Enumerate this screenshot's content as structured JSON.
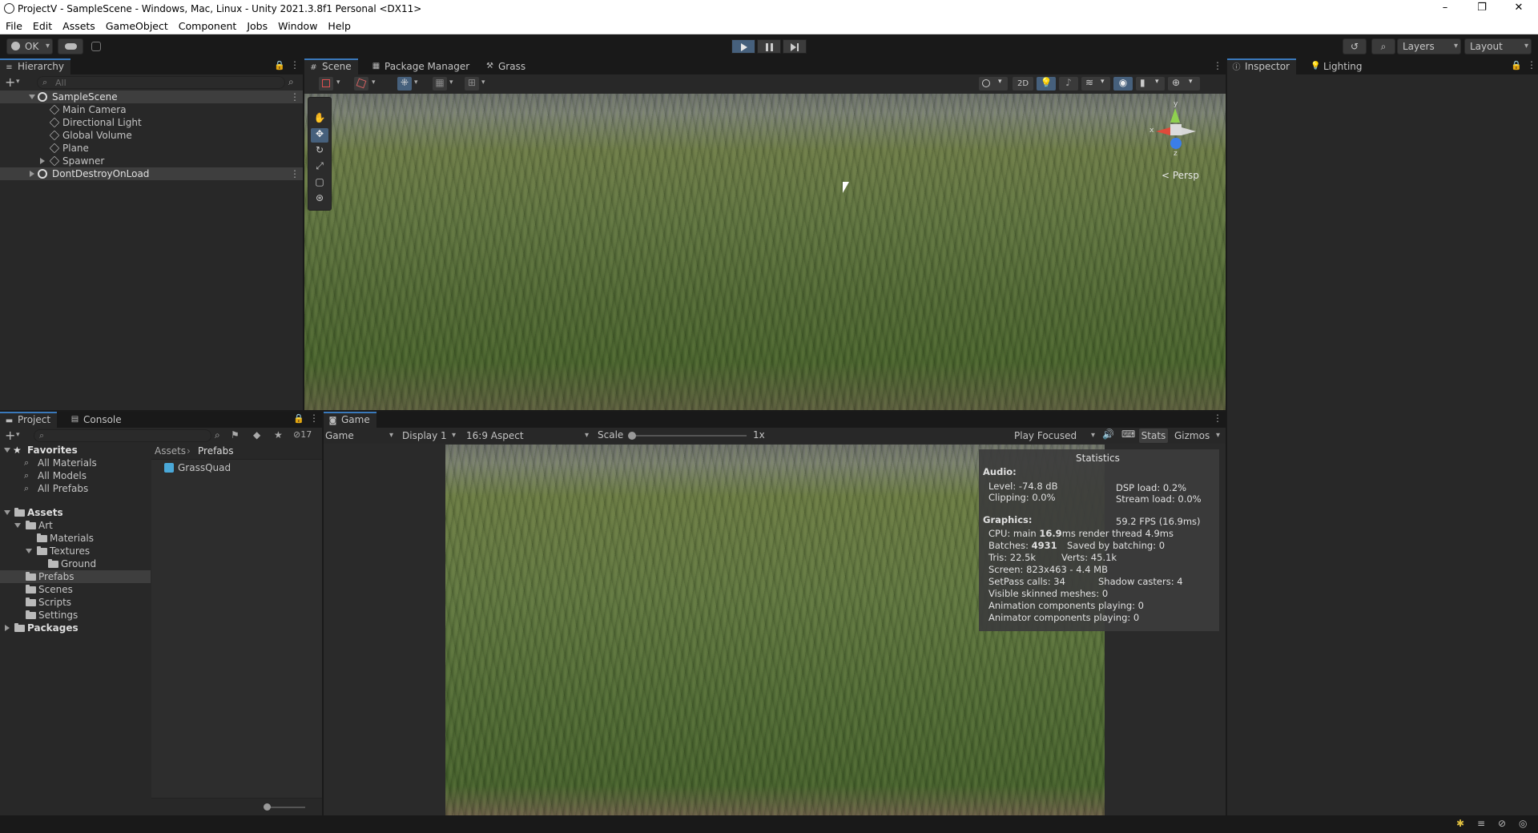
{
  "window": {
    "title": "ProjectV - SampleScene - Windows, Mac, Linux - Unity 2021.3.8f1 Personal <DX11>",
    "controls": [
      "–",
      "❐",
      "✕"
    ]
  },
  "menu": [
    "File",
    "Edit",
    "Assets",
    "GameObject",
    "Component",
    "Jobs",
    "Window",
    "Help"
  ],
  "toolbar": {
    "account_label": "OK",
    "layers_label": "Layers",
    "layout_label": "Layout"
  },
  "hierarchy": {
    "tab_label": "Hierarchy",
    "search_placeholder": "All",
    "items": [
      {
        "label": "SampleScene",
        "level": 0,
        "expanded": true,
        "scene": true,
        "selected": true
      },
      {
        "label": "Main Camera",
        "level": 1
      },
      {
        "label": "Directional Light",
        "level": 1
      },
      {
        "label": "Global Volume",
        "level": 1
      },
      {
        "label": "Plane",
        "level": 1
      },
      {
        "label": "Spawner",
        "level": 1,
        "expandable": true
      },
      {
        "label": "DontDestroyOnLoad",
        "level": 0,
        "expanded": false,
        "scene": true,
        "selected": true
      }
    ]
  },
  "scene_tabs": {
    "scene": "Scene",
    "package_manager": "Package Manager",
    "grass": "Grass"
  },
  "scene_view": {
    "btn_2d": "2D",
    "persp_label": "< Persp",
    "axis_x": "x",
    "axis_y": "y",
    "axis_z": "z"
  },
  "inspector_tabs": {
    "inspector": "Inspector",
    "lighting": "Lighting"
  },
  "project": {
    "tab_label": "Project",
    "console_label": "Console",
    "hidden_count": "17",
    "breadcrumb": [
      "Assets",
      "Prefabs"
    ],
    "favorites": {
      "label": "Favorites",
      "items": [
        "All Materials",
        "All Models",
        "All Prefabs"
      ]
    },
    "assets": {
      "label": "Assets",
      "items": [
        {
          "label": "Art",
          "level": 1,
          "expanded": true
        },
        {
          "label": "Materials",
          "level": 2
        },
        {
          "label": "Textures",
          "level": 2,
          "expanded": true
        },
        {
          "label": "Ground",
          "level": 3
        },
        {
          "label": "Prefabs",
          "level": 1,
          "selected": true
        },
        {
          "label": "Scenes",
          "level": 1
        },
        {
          "label": "Scripts",
          "level": 1
        },
        {
          "label": "Settings",
          "level": 1
        }
      ]
    },
    "packages_label": "Packages",
    "files": [
      "GrassQuad"
    ]
  },
  "game": {
    "tab_label": "Game",
    "view_select": "Game",
    "display_select": "Display 1",
    "aspect_select": "16:9 Aspect",
    "scale_label": "Scale",
    "scale_value": "1x",
    "play_focused": "Play Focused",
    "stats_btn": "Stats",
    "gizmos_btn": "Gizmos"
  },
  "statistics": {
    "title": "Statistics",
    "audio_header": "Audio:",
    "level": "Level: -74.8 dB",
    "clipping": "Clipping: 0.0%",
    "dsp_load": "DSP load: 0.2%",
    "stream_load": "Stream load: 0.0%",
    "graphics_header": "Graphics:",
    "fps": "59.2 FPS (16.9ms)",
    "cpu_prefix": "CPU: main ",
    "cpu_main": "16.9",
    "cpu_suffix": "ms  render thread 4.9ms",
    "batches_prefix": "Batches: ",
    "batches_value": "4931",
    "saved_batching": "Saved by batching: 0",
    "tris": "Tris: 22.5k",
    "verts": "Verts: 45.1k",
    "screen": "Screen: 823x463 - 4.4 MB",
    "setpass": "SetPass calls: 34",
    "shadow_casters": "Shadow casters: 4",
    "skinned_meshes": "Visible skinned meshes: 0",
    "anim_components": "Animation components playing: 0",
    "animator_components": "Animator components playing: 0"
  }
}
